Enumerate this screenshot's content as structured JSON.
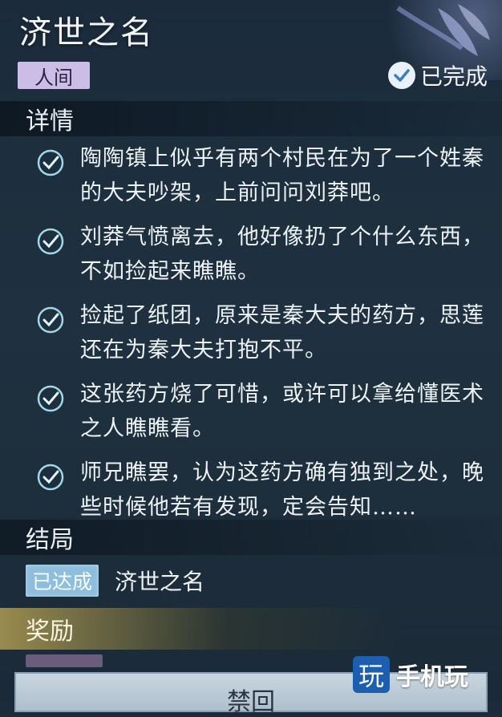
{
  "quest": {
    "title": "济世之名",
    "category_tag": "人间",
    "status": "已完成"
  },
  "details": {
    "header": "详情",
    "items": [
      {
        "text": "陶陶镇上似乎有两个村民在为了一个姓秦的大夫吵架，上前问问刘莽吧。"
      },
      {
        "text": "刘莽气愤离去，他好像扔了个什么东西，不如捡起来瞧瞧。"
      },
      {
        "text": "捡起了纸团，原来是秦大夫的药方，思莲还在为秦大夫打抱不平。"
      },
      {
        "text": "这张药方烧了可惜，或许可以拿给懂医术之人瞧瞧看。"
      },
      {
        "text": "师兄瞧罢，认为这药方确有独到之处，晚些时候他若有发现，定会告知……"
      }
    ]
  },
  "ending": {
    "header": "结局",
    "badge": "已达成",
    "name": "济世之名"
  },
  "reward": {
    "header": "奖励"
  },
  "return_button": {
    "label": "禁回"
  },
  "watermark": {
    "logo": "玩",
    "text": "手机玩"
  }
}
